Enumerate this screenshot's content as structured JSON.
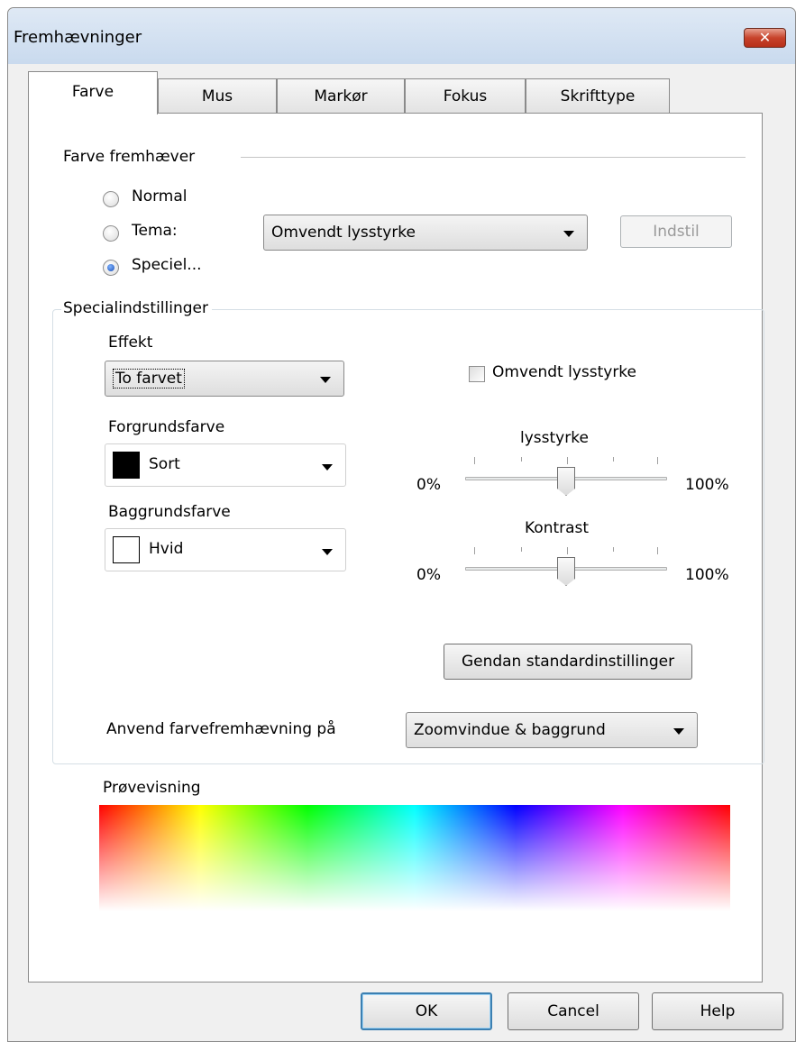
{
  "window": {
    "title": "Fremhævninger",
    "close_glyph": "✕"
  },
  "tabs": [
    {
      "label": "Farve",
      "active": true
    },
    {
      "label": "Mus"
    },
    {
      "label": "Markør"
    },
    {
      "label": "Fokus"
    },
    {
      "label": "Skrifttype"
    }
  ],
  "color_highlight": {
    "section_label": "Farve fremhæver",
    "radios": [
      {
        "label": "Normal",
        "checked": false
      },
      {
        "label": "Tema:",
        "checked": false
      },
      {
        "label": "Speciel...",
        "checked": true
      }
    ],
    "theme_select": "Omvendt lysstyrke",
    "setup_button": "Indstil"
  },
  "special": {
    "group_label": "Specialindstillinger",
    "effect_label": "Effekt",
    "effect_value": "To farvet",
    "invert_checkbox": {
      "label": "Omvendt lysstyrke",
      "checked": false
    },
    "foreground_label": "Forgrundsfarve",
    "foreground_value": "Sort",
    "foreground_color": "#000000",
    "background_label": "Baggrundsfarve",
    "background_value": "Hvid",
    "background_color": "#ffffff",
    "brightness_label": "lysstyrke",
    "brightness_min": "0%",
    "brightness_max": "100%",
    "brightness_value": 0.5,
    "contrast_label": "Kontrast",
    "contrast_min": "0%",
    "contrast_max": "100%",
    "contrast_value": 0.5,
    "restore_button": "Gendan standardinstillinger",
    "apply_label": "Anvend farvefremhævning på",
    "apply_value": "Zoomvindue & baggrund"
  },
  "preview": {
    "label": "Prøvevisning"
  },
  "footer": {
    "ok": "OK",
    "cancel": "Cancel",
    "help": "Help"
  }
}
